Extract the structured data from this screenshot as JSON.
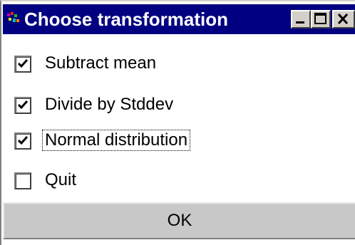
{
  "window": {
    "title": "Choose transformation",
    "icon": "app-icon",
    "controls": {
      "minimize_icon": "minimize-icon",
      "maximize_icon": "maximize-icon",
      "close_icon": "close-icon"
    }
  },
  "options": [
    {
      "label": "Subtract mean",
      "checked": true,
      "focused": false
    },
    {
      "label": "Divide by Stddev",
      "checked": true,
      "focused": false
    },
    {
      "label": "Normal distribution",
      "checked": true,
      "focused": true
    },
    {
      "label": "Quit",
      "checked": false,
      "focused": false
    }
  ],
  "ok_button": {
    "label": "OK"
  },
  "colors": {
    "titlebar": "#000080",
    "button_face": "#c8c8c8",
    "background": "#ffffff"
  }
}
